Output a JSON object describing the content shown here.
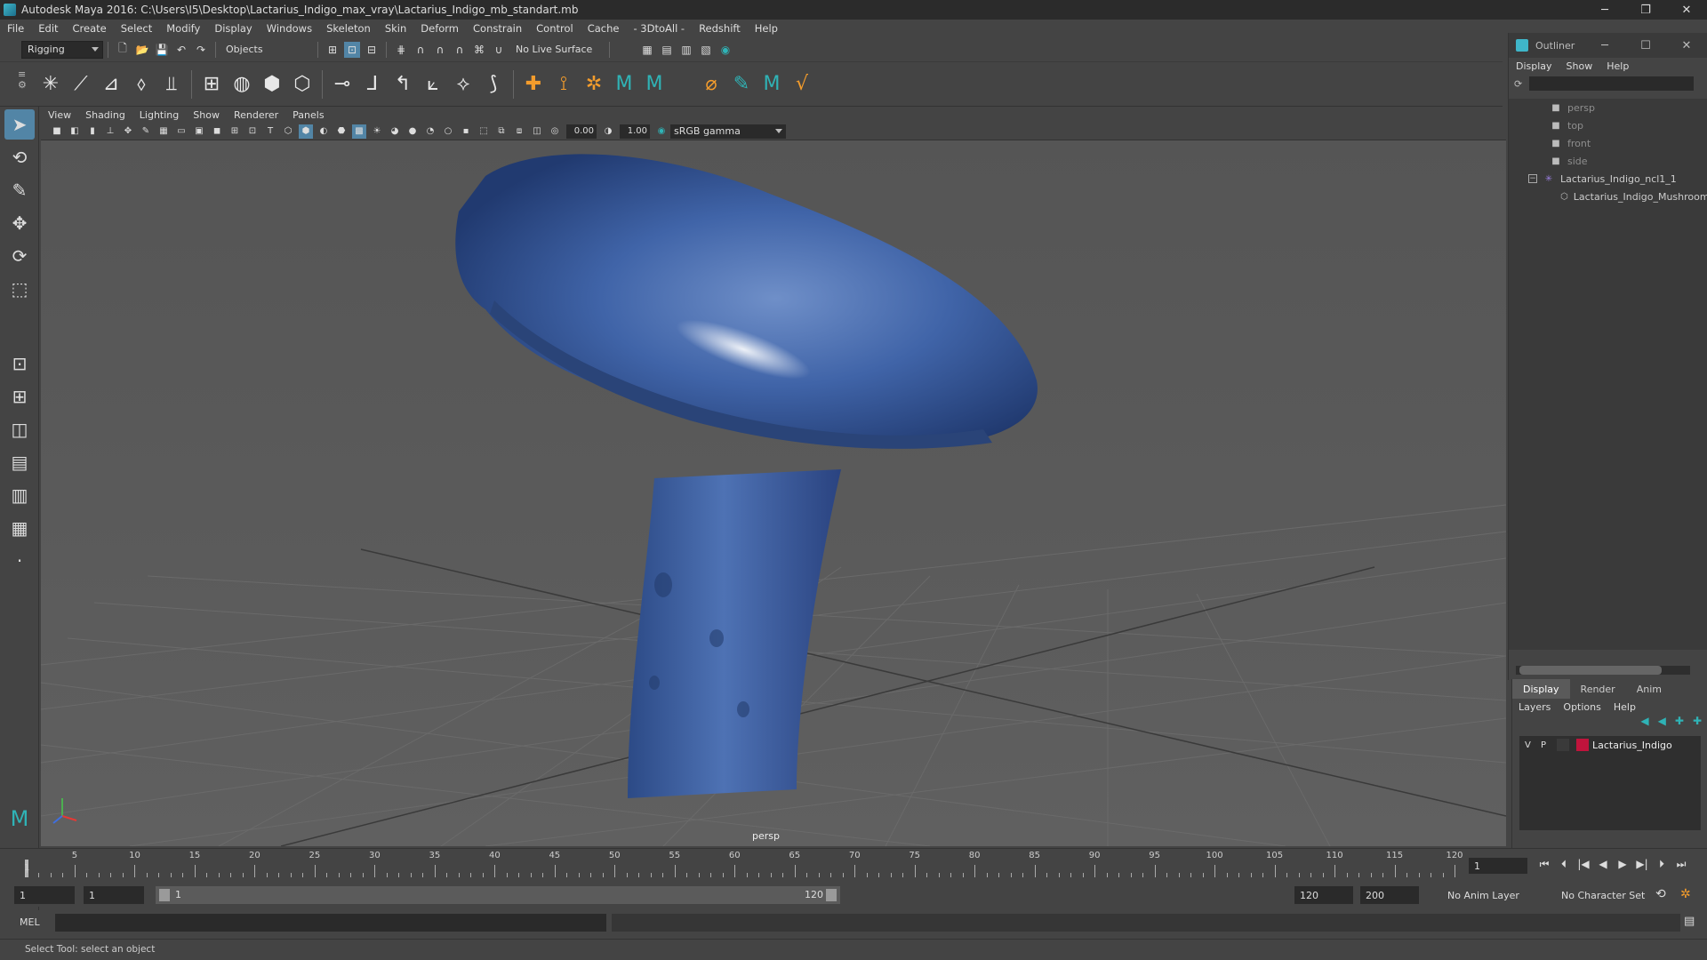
{
  "window": {
    "title": "Autodesk Maya 2016: C:\\Users\\I5\\Desktop\\Lactarius_Indigo_max_vray\\Lactarius_Indigo_mb_standart.mb",
    "minimize": "─",
    "restore": "❐",
    "close": "✕"
  },
  "menubar": [
    "File",
    "Edit",
    "Create",
    "Select",
    "Modify",
    "Display",
    "Windows",
    "Skeleton",
    "Skin",
    "Deform",
    "Constrain",
    "Control",
    "Cache",
    "- 3DtoAll -",
    "Redshift",
    "Help"
  ],
  "statusline": {
    "mode": "Rigging",
    "selection_mode": "Objects",
    "live_surface": "No Live Surface"
  },
  "viewport": {
    "menu": [
      "View",
      "Shading",
      "Lighting",
      "Show",
      "Renderer",
      "Panels"
    ],
    "exposure": "0.00",
    "gamma": "1.00",
    "color_management": "sRGB gamma",
    "camera": "persp"
  },
  "outliner": {
    "title": "Outliner",
    "menu": [
      "Display",
      "Show",
      "Help"
    ],
    "items": [
      {
        "label": "persp",
        "dim": true
      },
      {
        "label": "top",
        "dim": true
      },
      {
        "label": "front",
        "dim": true
      },
      {
        "label": "side",
        "dim": true
      },
      {
        "label": "Lactarius_Indigo_ncl1_1",
        "dim": false
      },
      {
        "label": "Lactarius_Indigo_Mushroom",
        "dim": false
      }
    ]
  },
  "layers": {
    "tabs": [
      "Display",
      "Render",
      "Anim"
    ],
    "active_tab": "Display",
    "menu": [
      "Layers",
      "Options",
      "Help"
    ],
    "rows": [
      {
        "v": "V",
        "p": "P",
        "name": "Lactarius_Indigo",
        "color": "#c0143c"
      }
    ]
  },
  "timeline": {
    "ticks": [
      "5",
      "10",
      "15",
      "20",
      "25",
      "30",
      "35",
      "40",
      "45",
      "50",
      "55",
      "60",
      "65",
      "70",
      "75",
      "80",
      "85",
      "90",
      "95",
      "100",
      "105",
      "110",
      "115",
      "120"
    ],
    "first_label": "1",
    "current_frame": "1"
  },
  "range": {
    "start": "1",
    "anim_start": "1",
    "range_start": "1",
    "range_end": "120",
    "anim_end": "120",
    "end": "200",
    "anim_layer": "No Anim Layer",
    "character_set": "No Character Set"
  },
  "command": {
    "language": "MEL"
  },
  "help_line": "Select Tool: select an object"
}
